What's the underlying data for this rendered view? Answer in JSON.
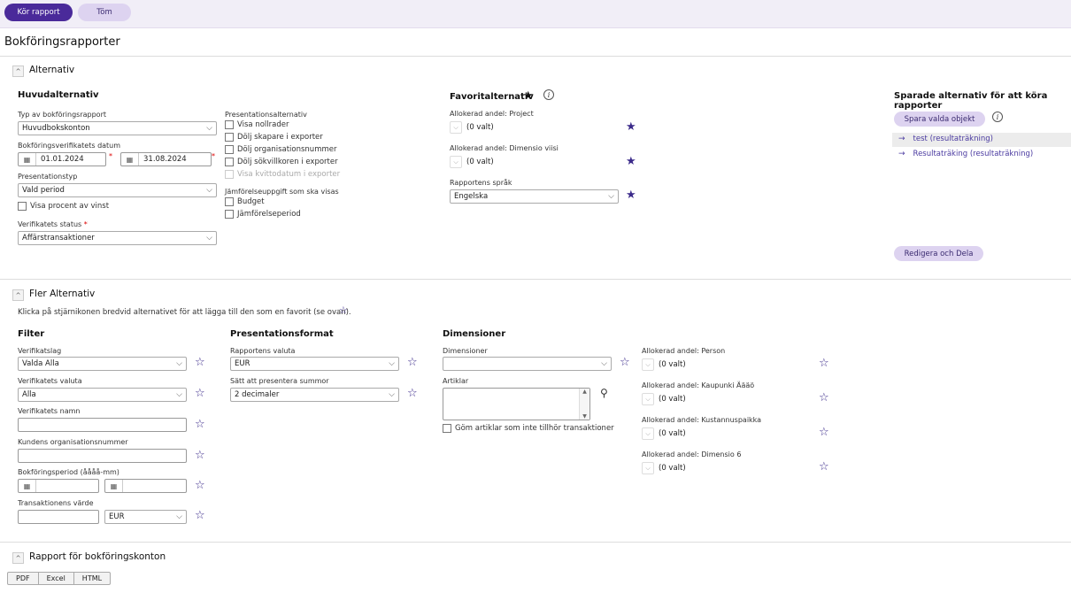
{
  "toolbar": {
    "run_label": "Kör rapport",
    "clear_label": "Töm"
  },
  "page_title": "Bokföringsrapporter",
  "alt_section": {
    "title": "Alternativ",
    "main_title": "Huvudalternativ",
    "report_type_label": "Typ av bokföringsrapport",
    "report_type_value": "Huvudbokskonton",
    "voucher_date_label": "Bokföringsverifikatets datum",
    "date_from": "01.01.2024",
    "date_to": "31.08.2024",
    "pres_type_label": "Presentationstyp",
    "pres_type_value": "Vald period",
    "show_percent_label": "Visa procent av vinst",
    "status_label": "Verifikatets status",
    "status_value": "Affärstransaktioner",
    "pres_alt_label": "Presentationsalternativ",
    "pres_options": [
      "Visa nollrader",
      "Dölj skapare i exporter",
      "Dölj organisationsnummer",
      "Dölj sökvillkoren i exporter",
      "Visa kvittodatum i exporter"
    ],
    "compare_label": "Jämförelseuppgift som ska visas",
    "compare_options": [
      "Budget",
      "Jämförelseperiod"
    ],
    "fav_title": "Favoritalternativ",
    "fav_project_label": "Allokerad andel: Project",
    "fav_project_value": "(0 valt)",
    "fav_dim_label": "Allokerad andel: Dimensio viisi",
    "fav_dim_value": "(0 valt)",
    "lang_label": "Rapportens språk",
    "lang_value": "Engelska",
    "saved_title": "Sparade alternativ för att köra rapporter",
    "save_selected_label": "Spara valda objekt",
    "saved_items": [
      "test (resultaträkning)",
      "Resultaträking (resultaträkning)"
    ],
    "edit_share_label": "Redigera och Dela"
  },
  "more_section": {
    "title": "Fler Alternativ",
    "hint": "Klicka på stjärnikonen bredvid alternativet för att lägga till den som en favorit (se ovan).",
    "filter_title": "Filter",
    "voucher_type_label": "Verifikatslag",
    "voucher_type_value": "Valda Alla",
    "voucher_currency_label": "Verifikatets valuta",
    "voucher_currency_value": "Alla",
    "voucher_name_label": "Verifikatets namn",
    "customer_org_label": "Kundens organisationsnummer",
    "posting_period_label": "Bokföringsperiod (åååå-mm)",
    "tx_value_label": "Transaktionens värde",
    "tx_currency_value": "EUR",
    "pres_format_title": "Presentationsformat",
    "report_currency_label": "Rapportens valuta",
    "report_currency_value": "EUR",
    "sum_label": "Sätt att presentera summor",
    "sum_value": "2 decimaler",
    "dim_title": "Dimensioner",
    "dimensions_label": "Dimensioner",
    "articles_label": "Artiklar",
    "hide_articles_label": "Göm artiklar som inte tillhör transaktioner",
    "alloc": [
      {
        "label": "Allokerad andel: Person",
        "value": "(0 valt)"
      },
      {
        "label": "Allokerad andel: Kaupunki Äääö",
        "value": "(0 valt)"
      },
      {
        "label": "Allokerad andel: Kustannuspaikka",
        "value": "(0 valt)"
      },
      {
        "label": "Allokerad andel: Dimensio 6",
        "value": "(0 valt)"
      }
    ]
  },
  "report_section": {
    "title": "Rapport för bokföringskonton",
    "formats": [
      "PDF",
      "Excel",
      "HTML"
    ]
  },
  "colors": {
    "accent": "#4a2a9a",
    "accent_light": "#ddd3f0",
    "star": "#3b2a8a"
  }
}
